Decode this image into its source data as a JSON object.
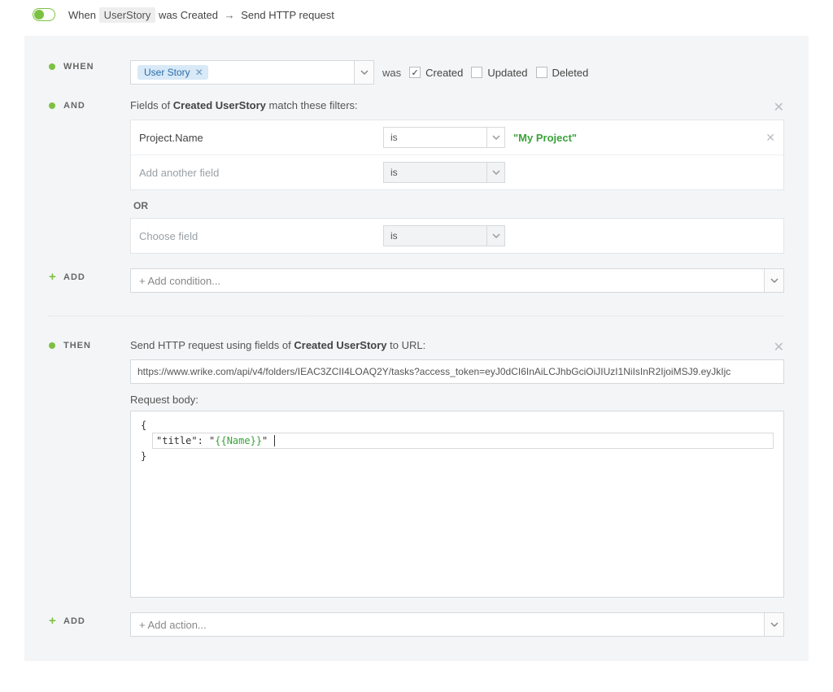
{
  "header": {
    "prefix": "When",
    "entity_tag": "UserStory",
    "mid": "was Created",
    "arrow": "→",
    "action": "Send HTTP request"
  },
  "when": {
    "label": "When",
    "chip": "User Story",
    "was": "was",
    "options": {
      "created": {
        "label": "Created",
        "checked": true
      },
      "updated": {
        "label": "Updated",
        "checked": false
      },
      "deleted": {
        "label": "Deleted",
        "checked": false
      }
    }
  },
  "and": {
    "label": "And",
    "desc_pre": "Fields of ",
    "desc_bold": "Created UserStory",
    "desc_post": " match these filters:",
    "groups": [
      {
        "rows": [
          {
            "field": "Project.Name",
            "op": "is",
            "value": "\"My Project\"",
            "enabled": true,
            "removable": true
          },
          {
            "field_placeholder": "Add another field",
            "op": "is",
            "enabled": false
          }
        ]
      },
      {
        "or_label": "OR",
        "rows": [
          {
            "field_placeholder": "Choose field",
            "op": "is",
            "enabled": false
          }
        ]
      }
    ]
  },
  "add_condition": {
    "label": "Add",
    "placeholder": "+ Add condition..."
  },
  "then": {
    "label": "Then",
    "desc_pre": "Send HTTP request using fields of ",
    "desc_bold": "Created UserStory",
    "desc_post": " to URL:",
    "url": "https://www.wrike.com/api/v4/folders/IEAC3ZCII4LOAQ2Y/tasks?access_token=eyJ0dCI6InAiLCJhbGciOiJIUzI1NiIsInR2IjoiMSJ9.eyJkIjc",
    "body_label": "Request body:",
    "body_open": "{",
    "body_line_pre": "\"title\": \"",
    "body_line_templ": "{{Name}}",
    "body_line_post": "\"",
    "body_close": "}"
  },
  "add_action": {
    "label": "Add",
    "placeholder": "+ Add action..."
  }
}
